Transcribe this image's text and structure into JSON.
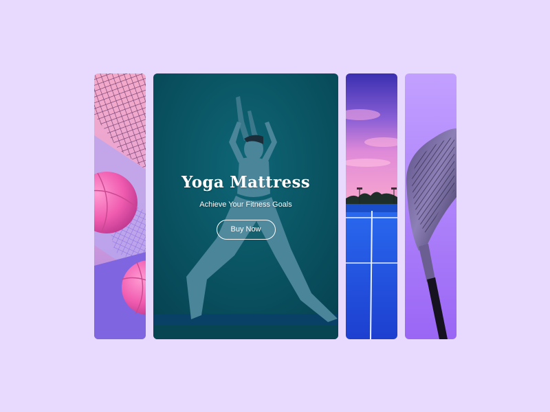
{
  "carousel": {
    "active_slide": {
      "title": "Yoga Mattress",
      "subtitle": "Achieve Your Fitness Goals",
      "cta_label": "Buy Now"
    }
  },
  "colors": {
    "page_background": "#e8d9ff",
    "yoga_background": "#0b5566",
    "basketball_pink": "#f26bb5",
    "court_blue": "#1f4fe0",
    "golf_purple": "#a675ff"
  }
}
